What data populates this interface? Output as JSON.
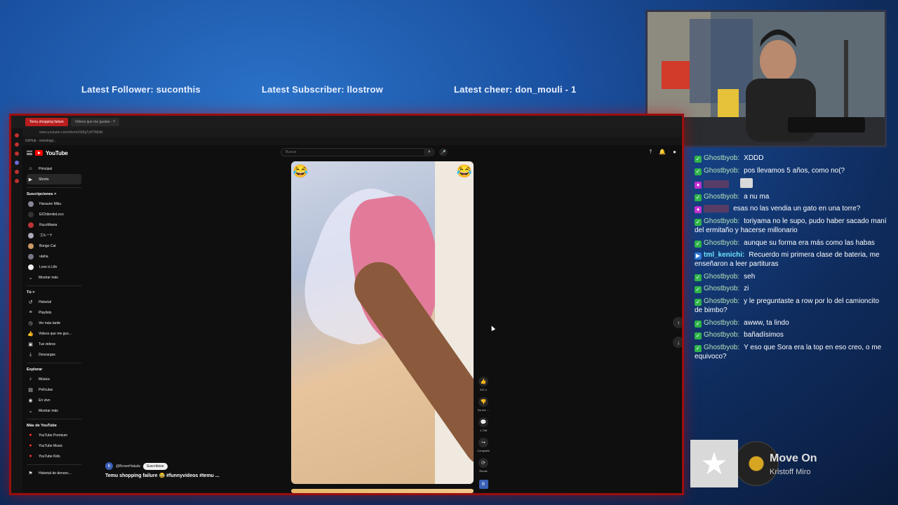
{
  "overlay": {
    "latest_follower": "Latest Follower: suconthis",
    "latest_subscriber": "Latest Subscriber: llostrow",
    "latest_cheer": "Latest cheer: don_mouli - 1"
  },
  "browser": {
    "tabs": [
      {
        "label": "Temu shopping failure"
      },
      {
        "label": "Videos que me gustan - Y"
      }
    ],
    "url": "www.youtube.com/shorts/SMgTyR7Mj4ik",
    "bookmark": "GitHub - wiredopp..."
  },
  "youtube": {
    "logo_text": "YouTube",
    "search_placeholder": "Buscar",
    "nav_primary": [
      {
        "label": "Principal",
        "icon": "home-icon"
      },
      {
        "label": "Shorts",
        "icon": "shorts-icon"
      }
    ],
    "subscriptions_title": "Suscripciones  >",
    "subscriptions": [
      {
        "label": "Haraune Miku"
      },
      {
        "label": "ElChilenitoLoco"
      },
      {
        "label": "RucoMania"
      },
      {
        "label": "ゴルーY"
      },
      {
        "label": "Bongo Cat"
      },
      {
        "label": "utaha"
      },
      {
        "label": "Love is Life"
      },
      {
        "label": "Mostrar más"
      }
    ],
    "you_title": "Tú  >",
    "you_items": [
      {
        "label": "Historial",
        "icon": "history-icon"
      },
      {
        "label": "Playlists",
        "icon": "playlist-icon"
      },
      {
        "label": "Ver más tarde",
        "icon": "clock-icon"
      },
      {
        "label": "Videos que me gus...",
        "icon": "thumb-up-icon"
      },
      {
        "label": "Tus videos",
        "icon": "video-icon"
      },
      {
        "label": "Descargas",
        "icon": "download-icon"
      }
    ],
    "explore_title": "Explorar",
    "explore_items": [
      {
        "label": "Música",
        "icon": "music-icon"
      },
      {
        "label": "Películas",
        "icon": "film-icon"
      },
      {
        "label": "En vivo",
        "icon": "live-icon"
      },
      {
        "label": "Mostrar más",
        "icon": "chevron-down-icon"
      }
    ],
    "more_title": "Más de YouTube",
    "more_items": [
      {
        "label": "YouTube Premium"
      },
      {
        "label": "YouTube Music"
      },
      {
        "label": "YouTube Kids"
      }
    ],
    "report_history": "Historial de denunc...",
    "short": {
      "emoji": "😂",
      "channel": "@BrownHakala",
      "channel_initial": "B",
      "subscribe": "Suscribirse",
      "title": "Temu shopping failure 😂 #funnyvideos #temu ...",
      "likes": "321 k",
      "dislike": "No me ...",
      "comments": "1,748",
      "share": "Compartir",
      "remix": "Remix"
    }
  },
  "chat": [
    {
      "badge": "check",
      "user": "Ghostbyob:",
      "text": "XDDD"
    },
    {
      "badge": "check",
      "user": "Ghostbyob:",
      "text": "pos llevamos 5 años, como no(?"
    },
    {
      "badge": "gem",
      "user": "",
      "text": "",
      "emote": true
    },
    {
      "badge": "check",
      "user": "Ghostbyob:",
      "text": "a nu ma"
    },
    {
      "badge": "gem",
      "user": "",
      "text": "esas no las vendia un gato en una torre?"
    },
    {
      "badge": "check",
      "user": "Ghostbyob:",
      "text": "toriyama no le supo, pudo haber sacado maní del ermitaño y hacerse millonario"
    },
    {
      "badge": "check",
      "user": "Ghostbyob:",
      "text": "aunque su forma era más como las habas"
    },
    {
      "badge": "prime",
      "user": "tml_kenichi:",
      "text": "Recuerdo mi primera clase de bateria, me enseñaron a leer partituras"
    },
    {
      "badge": "check",
      "user": "Ghostbyob:",
      "text": "seh"
    },
    {
      "badge": "check",
      "user": "Ghostbyob:",
      "text": "zi"
    },
    {
      "badge": "check",
      "user": "Ghostbyob:",
      "text": "y le preguntaste a row por lo del camioncito de bimbo?"
    },
    {
      "badge": "check",
      "user": "Ghostbyob:",
      "text": "awww, ta lindo"
    },
    {
      "badge": "check",
      "user": "Ghostbyob:",
      "text": "bañadísimos"
    },
    {
      "badge": "check",
      "user": "Ghostbyob:",
      "text": "Y eso que Sora era la top en eso creo, o me equivoco?"
    }
  ],
  "now_playing": {
    "title": "Move On",
    "artist": "Kristoff Miro"
  }
}
